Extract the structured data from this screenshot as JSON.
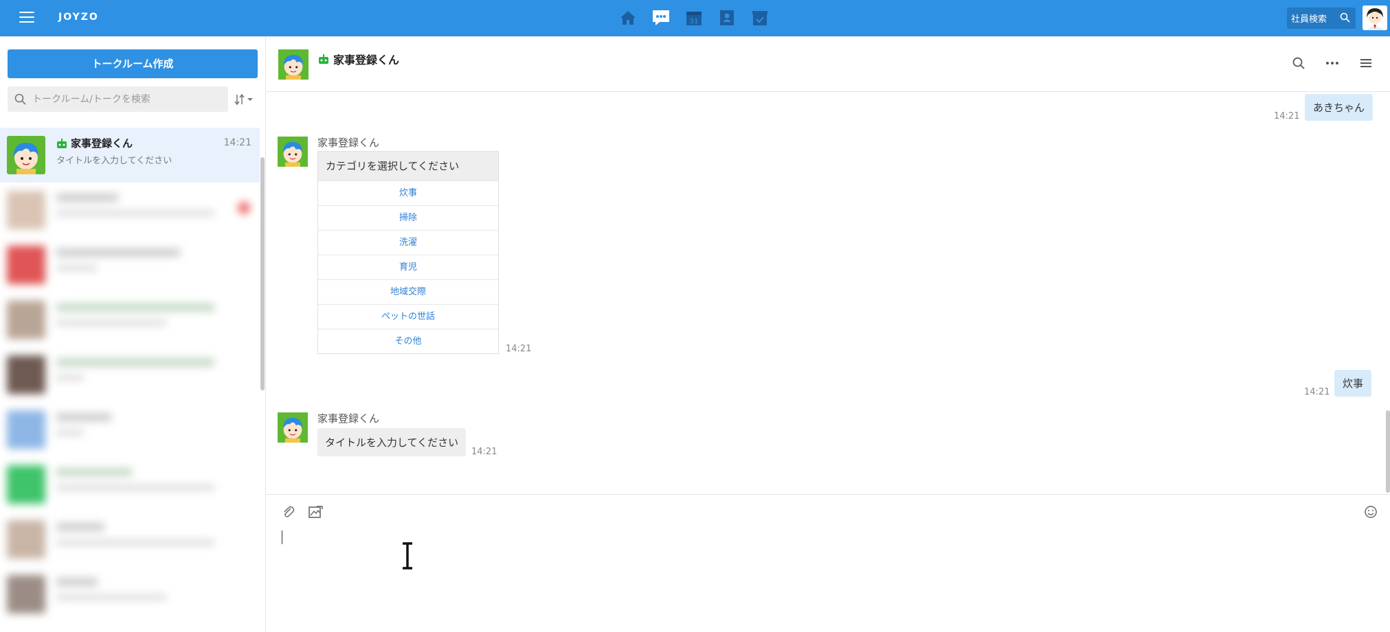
{
  "topbar": {
    "brand": "JOYZO",
    "employee_search_label": "社員検索",
    "nav": [
      "home-icon",
      "chat-icon",
      "calendar-icon",
      "contacts-icon",
      "tasks-icon"
    ],
    "calendar_day": "31",
    "bg_color": "#2f91e3"
  },
  "sidebar": {
    "create_label": "トークルーム作成",
    "search_placeholder": "トークルーム/トークを検索",
    "rooms": [
      {
        "name": "家事登録くん",
        "time": "14:21",
        "preview": "タイトルを入力してください",
        "active": true
      }
    ]
  },
  "chat": {
    "title": "家事登録くん",
    "messages": {
      "m1": {
        "text": "あきちゃん",
        "time": "14:21"
      },
      "m2": {
        "sender": "家事登録くん",
        "prompt": "カテゴリを選択してください",
        "options": [
          "炊事",
          "掃除",
          "洗濯",
          "育児",
          "地域交際",
          "ペットの世話",
          "その他"
        ],
        "time": "14:21"
      },
      "m3": {
        "text": "炊事",
        "time": "14:21"
      },
      "m4": {
        "sender": "家事登録くん",
        "text": "タイトルを入力してください",
        "time": "14:21"
      }
    }
  }
}
